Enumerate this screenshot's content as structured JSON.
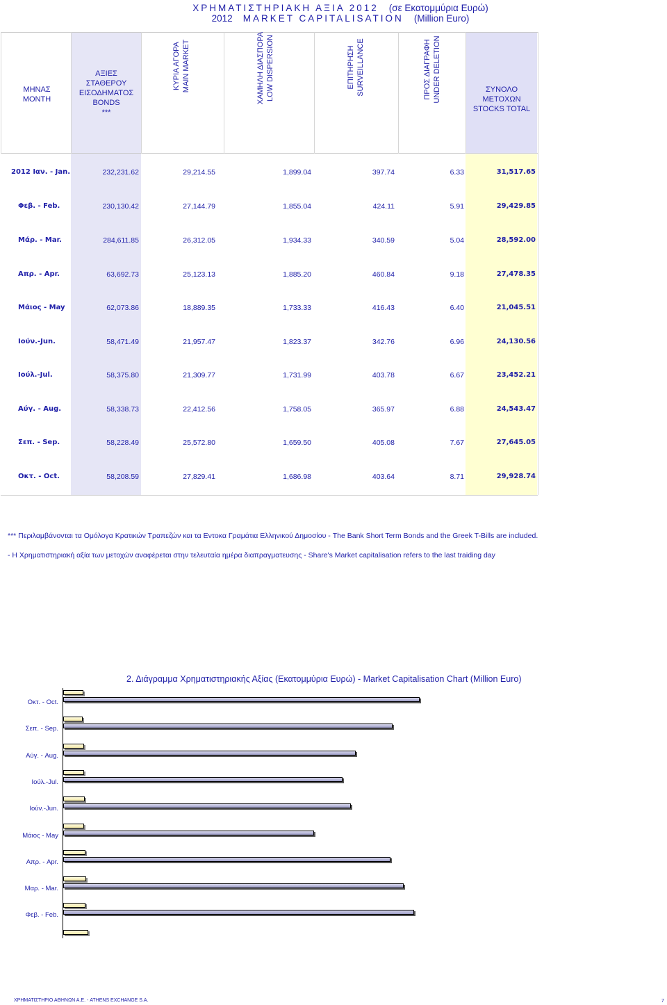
{
  "title": {
    "line1": "ΧΡΗΜΑΤΙΣΤΗΡΙΑΚΗ ΑΞΙΑ 2012",
    "line1_suffix": "(σε Εκατομμύρια Ευρώ)",
    "line2_year": "2012",
    "line2": "MARKET CAPITALISATION",
    "line2_suffix": "(Million Euro)"
  },
  "headers": {
    "month": "ΜΗΝΑΣ\nMONTH",
    "bonds": "ΑΞΙΕΣ\nΣΤΑΘΕΡΟΥ\nΕΙΣΟΔΗΜΑΤΟΣ\nBONDS\n***",
    "main": "ΚΥΡΙΑ ΑΓΟΡΑ\nMAIN MARKET",
    "low": "ΧΑΜΗΛΗ ΔΙΑΣΠΟΡΑ\nLOW DISPERSION",
    "surv": "ΕΠΙΤΗΡΗΣΗ\nSURVEILLANCE",
    "del": "ΠΡΟΣ ΔΙΑΓΡΑΦΗ\nUNDER DELETION",
    "total": "ΣΥΝΟΛΟ ΜΕΤΟΧΩΝ\nSTOCKS TOTAL"
  },
  "rows": [
    {
      "month": "2012   Ιαν. - Jan.",
      "bonds": "232,231.62",
      "main": "29,214.55",
      "low": "1,899.04",
      "surv": "397.74",
      "del": "6.33",
      "total": "31,517.65"
    },
    {
      "month": "Φεβ. - Feb.",
      "bonds": "230,130.42",
      "main": "27,144.79",
      "low": "1,855.04",
      "surv": "424.11",
      "del": "5.91",
      "total": "29,429.85"
    },
    {
      "month": "Μάρ. - Mar.",
      "bonds": "284,611.85",
      "main": "26,312.05",
      "low": "1,934.33",
      "surv": "340.59",
      "del": "5.04",
      "total": "28,592.00"
    },
    {
      "month": "Απρ. - Apr.",
      "bonds": "63,692.73",
      "main": "25,123.13",
      "low": "1,885.20",
      "surv": "460.84",
      "del": "9.18",
      "total": "27,478.35"
    },
    {
      "month": "Μάιος - May",
      "bonds": "62,073.86",
      "main": "18,889.35",
      "low": "1,733.33",
      "surv": "416.43",
      "del": "6.40",
      "total": "21,045.51"
    },
    {
      "month": "Ιούν.-Jun.",
      "bonds": "58,471.49",
      "main": "21,957.47",
      "low": "1,823.37",
      "surv": "342.76",
      "del": "6.96",
      "total": "24,130.56"
    },
    {
      "month": "Ιούλ.-Jul.",
      "bonds": "58,375.80",
      "main": "21,309.77",
      "low": "1,731.99",
      "surv": "403.78",
      "del": "6.67",
      "total": "23,452.21"
    },
    {
      "month": "Αύγ. - Aug.",
      "bonds": "58,338.73",
      "main": "22,412.56",
      "low": "1,758.05",
      "surv": "365.97",
      "del": "6.88",
      "total": "24,543.47"
    },
    {
      "month": "Σεπ. - Sep.",
      "bonds": "58,228.49",
      "main": "25,572.80",
      "low": "1,659.50",
      "surv": "405.08",
      "del": "7.67",
      "total": "27,645.05"
    },
    {
      "month": "Οκτ. - Oct.",
      "bonds": "58,208.59",
      "main": "27,829.41",
      "low": "1,686.98",
      "surv": "403.64",
      "del": "8.71",
      "total": "29,928.74"
    }
  ],
  "notes": {
    "n1": "*** Περιλαμβάνονται τα Ομόλογα Κρατικών Τραπεζών και τα Εντοκα Γραμάτια Ελληνικού Δημοσίου - The Bank Short Term Bonds and the Greek T-Bills are included.",
    "n2": "- Η Χρηματιστηριακή αξία των μετοχών αναφέρεται στην τελευταία ημέρα διαπραγματευσης - Share's Market capitalisation refers to the last traiding day"
  },
  "chart_data": {
    "type": "bar",
    "orientation": "horizontal",
    "title": "2. Διάγραμμα Χρηματιστηριακής Αξίας (Εκατομμύρια Ευρώ) - Market Capitalisation Chart (Million Euro)",
    "categories": [
      "Οκτ. - Oct.",
      "Σεπ. - Sep.",
      "Αύγ. - Aug.",
      "Ιούλ.-Jul.",
      "Ιούν.-Jun.",
      "Μάιος - May",
      "Απρ. - Apr.",
      "Μαρ. - Mar.",
      "Φεβ. - Feb."
    ],
    "series": [
      {
        "values": [
          1686.98,
          1659.5,
          1758.05,
          1731.99,
          1823.37,
          1733.33,
          1885.2,
          1934.33,
          1855.04
        ],
        "color": "#f3e9a8"
      },
      {
        "values": [
          29928.74,
          27645.05,
          24543.47,
          23452.21,
          24130.56,
          21045.51,
          27478.35,
          28592.0,
          29429.85
        ],
        "color": "#9e9ec8"
      }
    ],
    "xlim": [
      0,
      35000
    ],
    "grid": false,
    "legend": "none"
  },
  "footer": {
    "left": "ΧΡΗΜΑΤΙΣΤΗΡΙΟ ΑΘΗΝΩΝ Α.Ε. - ATHENS EXCHANGE S.A.",
    "page": "7"
  }
}
